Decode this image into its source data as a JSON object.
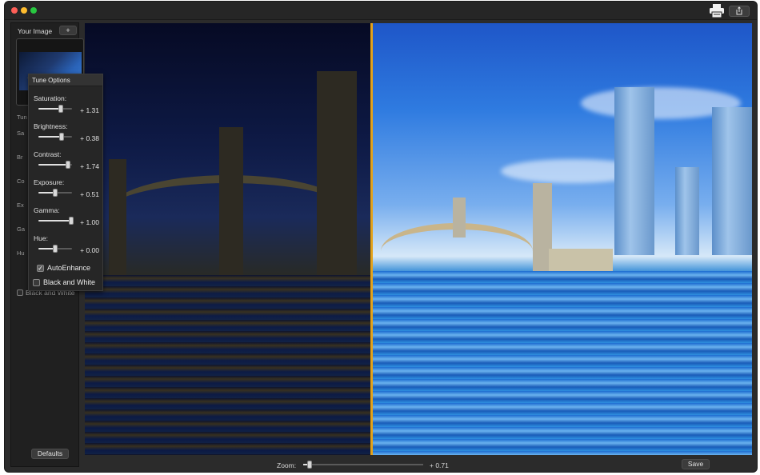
{
  "sidebar": {
    "title": "Your Image",
    "add_label": "+",
    "ghost_labels": [
      "Tun",
      "Sa",
      "Br",
      "Co",
      "Ex",
      "Ga",
      "Hu"
    ],
    "bw_label": "Black and White",
    "defaults_label": "Defaults"
  },
  "tune": {
    "title": "Tune Options",
    "options": [
      {
        "label": "Saturation:",
        "value": "+ 1.31",
        "level": 0.66
      },
      {
        "label": "Brightness:",
        "value": "+ 0.38",
        "level": 0.69
      },
      {
        "label": "Contrast:",
        "value": "+ 1.74",
        "level": 0.87
      },
      {
        "label": "Exposure:",
        "value": "+ 0.51",
        "level": 0.5
      },
      {
        "label": "Gamma:",
        "value": "+ 1.00",
        "level": 0.97
      },
      {
        "label": "Hue:",
        "value": "+ 0.00",
        "level": 0.5
      }
    ],
    "auto_enhance": {
      "label": "AutoEnhance",
      "checked": true
    },
    "black_white": {
      "label": "Black and White",
      "checked": false
    }
  },
  "bottom": {
    "zoom_label": "Zoom:",
    "zoom_value": "+ 0.71",
    "zoom_level": 0.05,
    "save_label": "Save"
  },
  "toolbar": {
    "print_icon": "printer-icon",
    "share_icon": "share-icon"
  },
  "colors": {
    "divider": "#e3a21a",
    "window_bg": "#2b2b2b"
  }
}
